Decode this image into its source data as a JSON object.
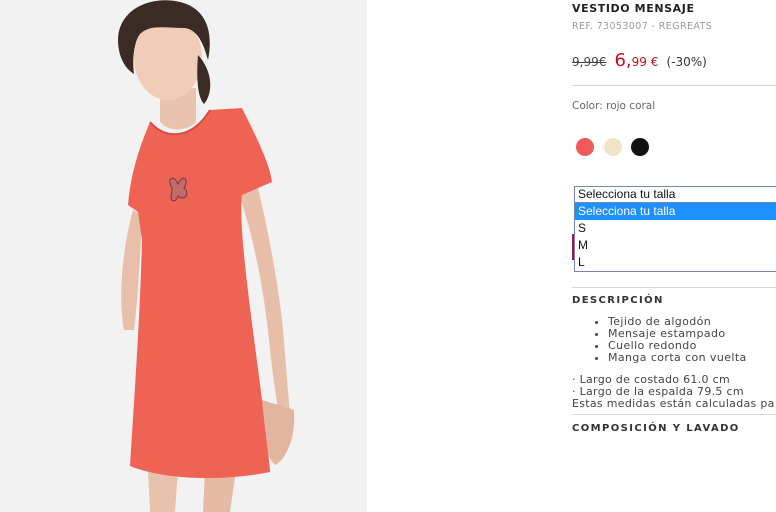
{
  "product": {
    "title": "VESTIDO MENSAJE",
    "ref": "REF. 73053007 - REGREATS",
    "old_price": "9,99€",
    "new_price_int": "6,",
    "new_price_dec": "99 €",
    "discount": "(-30%)",
    "color_label": "Color: rojo coral"
  },
  "colors": {
    "swatches": [
      {
        "name": "rojo coral",
        "hex": "#f05a5a"
      },
      {
        "name": "crudo",
        "hex": "#efe5c5"
      },
      {
        "name": "negro",
        "hex": "#111111"
      }
    ],
    "dress": "#ef6355",
    "price_red": "#c50f1f"
  },
  "size_select": {
    "current": "Selecciona tu talla",
    "options": [
      "Selecciona tu talla",
      "S",
      "M",
      "L"
    ]
  },
  "description": {
    "title": "DESCRIPCIÓN",
    "features": [
      "Tejido de algodón",
      "Mensaje estampado",
      "Cuello redondo",
      "Manga corta con vuelta"
    ],
    "measures": [
      "· Largo de costado 61.0 cm",
      "· Largo de la espalda 79.5 cm",
      "Estas medidas están calculadas pa"
    ]
  },
  "composition": {
    "title": "COMPOSICIÓN Y LAVADO"
  }
}
